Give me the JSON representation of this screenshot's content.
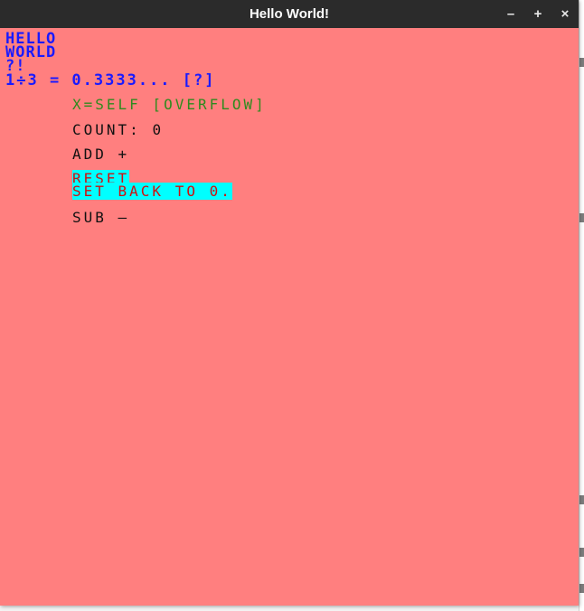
{
  "window": {
    "title": "Hello World!",
    "controls": {
      "minimize": "–",
      "maximize": "+",
      "close": "×"
    }
  },
  "colors": {
    "window_bg": "#ff7f7f",
    "titlebar": "#2b2b2b",
    "header_text": "#1a1aff",
    "self_text": "#2e8b1e",
    "button_text": "#111111",
    "reset_text": "#d01010",
    "highlight": "#00ffff"
  },
  "header": {
    "line1": "HELLO",
    "line2": "WORLD",
    "line3": "?!",
    "ratio": "1÷3 = 0.3333... [?]"
  },
  "self_line": "x=SELF [OVERFLOW]",
  "counter": {
    "label": "COUNT:",
    "value": "0"
  },
  "buttons": {
    "add": "ADD +",
    "reset_label": "RESET",
    "reset_desc": "SET BACK TO 0.",
    "sub": "SUB –"
  }
}
